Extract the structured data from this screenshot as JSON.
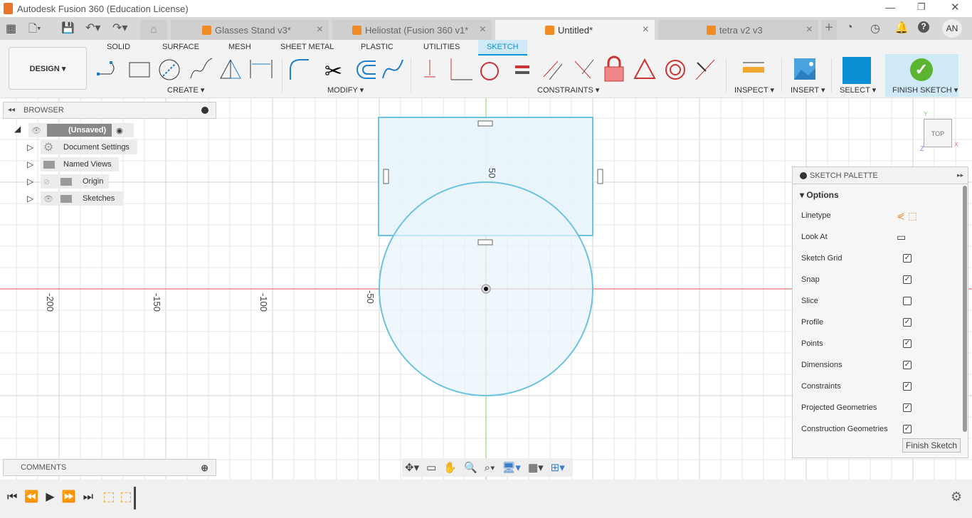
{
  "window": {
    "title": "Autodesk Fusion 360 (Education License)"
  },
  "tabs": [
    {
      "label": "Glasses Stand v3*"
    },
    {
      "label": "Heliostat (Fusion 360 v1*"
    },
    {
      "label": "Untitled*",
      "active": true
    },
    {
      "label": "tetra v2 v3"
    }
  ],
  "user": {
    "initials": "AN"
  },
  "toolbar": {
    "workspace": "DESIGN ▾",
    "tabs": [
      "SOLID",
      "SURFACE",
      "MESH",
      "SHEET METAL",
      "PLASTIC",
      "UTILITIES",
      "SKETCH"
    ],
    "active_tab": "SKETCH",
    "groups": {
      "create": "CREATE ▾",
      "modify": "MODIFY ▾",
      "constraints": "CONSTRAINTS ▾",
      "inspect": "INSPECT ▾",
      "insert": "INSERT ▾",
      "select": "SELECT ▾",
      "finish": "FINISH SKETCH ▾"
    }
  },
  "browser": {
    "title": "BROWSER",
    "root": "(Unsaved)",
    "items": [
      "Document Settings",
      "Named Views",
      "Origin",
      "Sketches"
    ]
  },
  "comments": {
    "title": "COMMENTS"
  },
  "viewcube": {
    "face": "TOP",
    "x": "X",
    "y": "Y",
    "z": "Z"
  },
  "canvas": {
    "axis_labels": [
      "-200",
      "-150",
      "-100",
      "-50"
    ],
    "dimension": "50"
  },
  "palette": {
    "title": "SKETCH PALETTE",
    "section": "Options",
    "options": [
      {
        "label": "Linetype"
      },
      {
        "label": "Look At"
      },
      {
        "label": "Sketch Grid",
        "checked": true
      },
      {
        "label": "Snap",
        "checked": true
      },
      {
        "label": "Slice",
        "checked": false
      },
      {
        "label": "Profile",
        "checked": true
      },
      {
        "label": "Points",
        "checked": true
      },
      {
        "label": "Dimensions",
        "checked": true
      },
      {
        "label": "Constraints",
        "checked": true
      },
      {
        "label": "Projected Geometries",
        "checked": true
      },
      {
        "label": "Construction Geometries",
        "checked": true
      }
    ],
    "finish_button": "Finish Sketch"
  },
  "colors": {
    "accent": "#0696d7",
    "sketch": "#6cc3e0",
    "profile_fill": "#e8f4fb",
    "x_axis": "#d9534f",
    "y_axis": "#7ccf6a",
    "finish": "#5cb531"
  }
}
